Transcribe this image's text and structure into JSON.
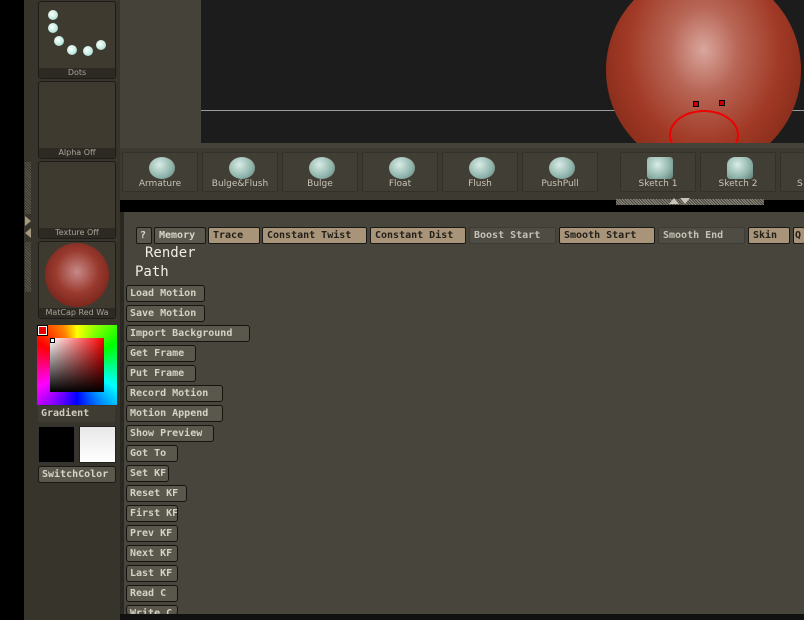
{
  "left_panel": {
    "brush_alpha": "Dots",
    "alpha": "Alpha  Off",
    "texture": "Texture  Off",
    "material": "MatCap  Red  Wa",
    "gradient": "Gradient",
    "switch_color": "SwitchColor"
  },
  "brushes": [
    "Armature",
    "Bulge&Flush",
    "Bulge",
    "Float",
    "Flush",
    "PushPull",
    "Sketch 1",
    "Sketch 2",
    "S"
  ],
  "toolbar": [
    "?",
    "Memory",
    "Trace",
    "Constant Twist",
    "Constant Dist",
    "Boost Start",
    "Smooth Start",
    "Smooth End",
    "Skin",
    "Q"
  ],
  "section": {
    "render": "Render",
    "path": "Path"
  },
  "buttons": [
    "Load Motion",
    "Save Motion",
    "Import Background",
    "Get Frame",
    "Put Frame",
    "Record Motion",
    "Motion Append",
    "Show Preview",
    "Got To",
    "Set KF",
    "Reset KF",
    "First KF",
    "Prev KF",
    "Next KF",
    "Last KF",
    "Read C",
    "Write C"
  ],
  "colors": {
    "active": "#a89479",
    "main": "#ff0000",
    "secondary": "#ffffff"
  }
}
